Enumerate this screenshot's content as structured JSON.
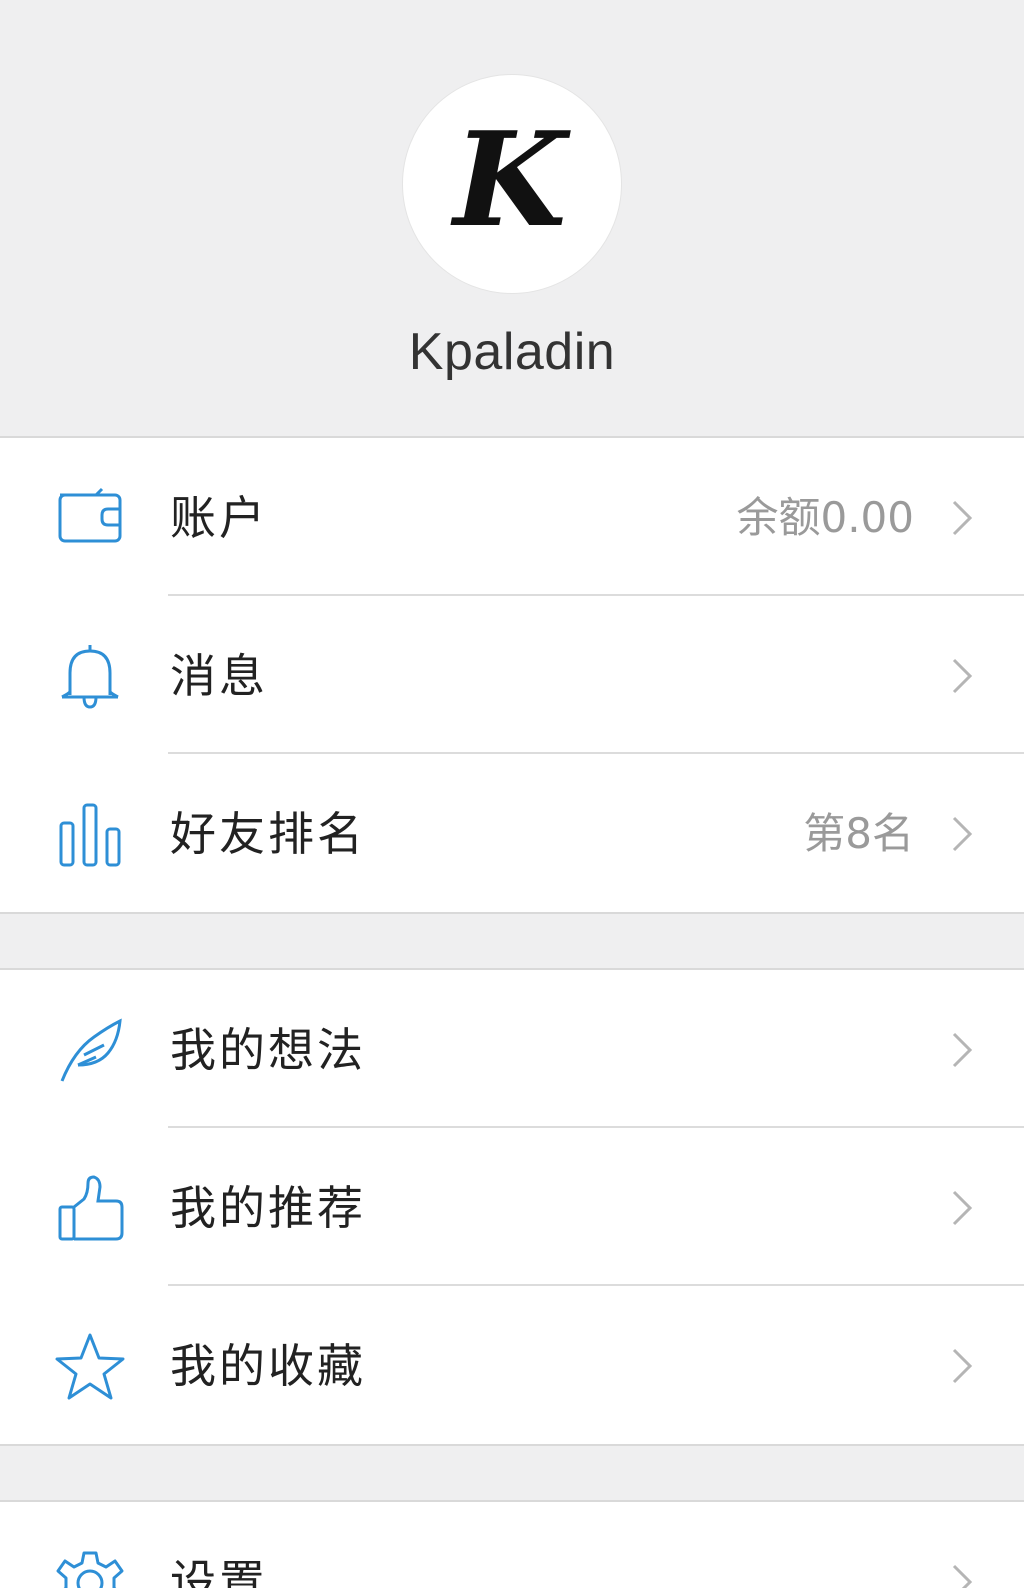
{
  "profile": {
    "avatar_letter": "K",
    "username": "Kpaladin"
  },
  "group1": [
    {
      "label": "账户",
      "value": "余额0.00",
      "icon": "wallet-icon"
    },
    {
      "label": "消息",
      "value": "",
      "icon": "bell-icon"
    },
    {
      "label": "好友排名",
      "value": "第8名",
      "icon": "bar-chart-icon"
    }
  ],
  "group2": [
    {
      "label": "我的想法",
      "icon": "feather-icon"
    },
    {
      "label": "我的推荐",
      "icon": "thumbs-up-icon"
    },
    {
      "label": "我的收藏",
      "icon": "star-icon"
    }
  ],
  "group3": [
    {
      "label": "设置",
      "icon": "gear-icon"
    }
  ],
  "colors": {
    "accent": "#2e8fd6",
    "background": "#efeff0",
    "value_text": "#9a9a9a",
    "chevron": "#b5b5b5"
  }
}
